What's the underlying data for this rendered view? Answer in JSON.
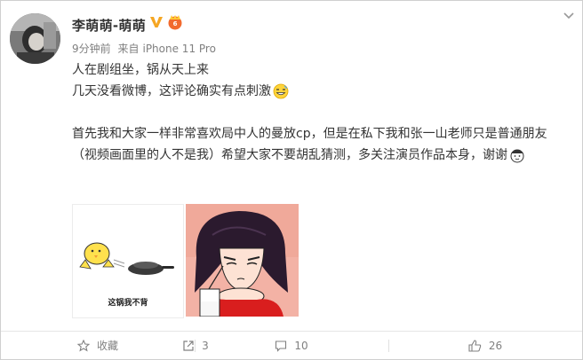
{
  "post": {
    "username": "李萌萌-萌萌",
    "time": "9分钟前",
    "source_prefix": "来自",
    "source": "iPhone 11 Pro",
    "line1": "人在剧组坐，锅从天上来",
    "line2": "几天没看微博，这评论确实有点刺激",
    "paragraph": "首先我和大家一样非常喜欢局中人的曼放cp，但是在私下我和张一山老师只是普通朋友（视频画面里的人不是我）希望大家不要胡乱猜测，多关注演员作品本身，谢谢",
    "image1_caption": "这锅我不背"
  },
  "footer": {
    "favorite_label": "收藏",
    "repost_count": "3",
    "comment_count": "10",
    "like_count": "26"
  },
  "colors": {
    "verified": "#f5a623",
    "text": "#333333",
    "meta": "#808080",
    "border": "#cfcfcf"
  },
  "icons": [
    "more-chevron-icon",
    "verified-v-icon",
    "vip-badge-icon",
    "grin-emoji-icon",
    "salute-emoji-icon",
    "star-icon",
    "repost-icon",
    "comment-icon",
    "like-icon"
  ]
}
